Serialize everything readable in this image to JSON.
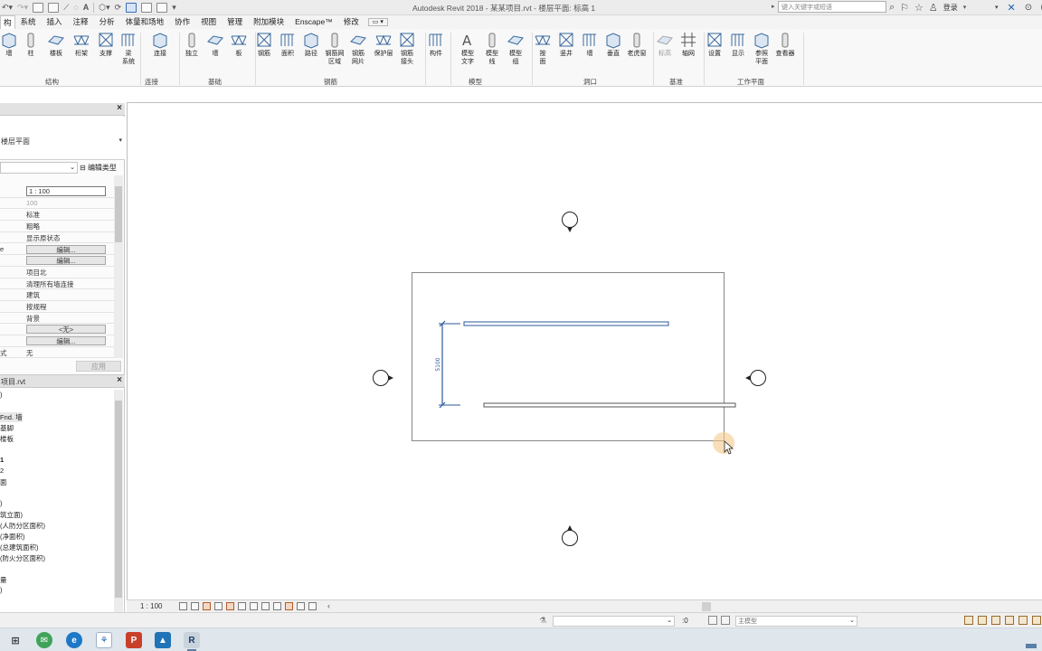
{
  "titlebar": {
    "title": "Autodesk Revit 2018 -    某某项目.rvt - 楼层平面: 标高 1",
    "search_placeholder": "键入关键字或短语",
    "login": "登录"
  },
  "tabs": [
    "构",
    "系统",
    "插入",
    "注释",
    "分析",
    "体量和场地",
    "协作",
    "视图",
    "管理",
    "附加模块",
    "Enscape™",
    "修改"
  ],
  "ribbon": {
    "buttons": [
      {
        "label": "墙"
      },
      {
        "label": "柱"
      },
      {
        "label": "楼板"
      },
      {
        "label": "桁架"
      },
      {
        "label": "支撑"
      },
      {
        "label": "梁\n系统"
      },
      {
        "label": "连接"
      },
      {
        "label": "独立"
      },
      {
        "label": "墙"
      },
      {
        "label": "板"
      },
      {
        "label": "钢筋"
      },
      {
        "label": "面积"
      },
      {
        "label": "路径"
      },
      {
        "label": "钢筋网\n区域"
      },
      {
        "label": "钢筋\n网片"
      },
      {
        "label": "保护层"
      },
      {
        "label": "钢筋\n接头"
      },
      {
        "label": "构件"
      },
      {
        "label": "模型\n文字"
      },
      {
        "label": "模型\n线"
      },
      {
        "label": "模型\n组"
      },
      {
        "label": "按\n面"
      },
      {
        "label": "竖井"
      },
      {
        "label": "墙"
      },
      {
        "label": "垂直"
      },
      {
        "label": "老虎窗"
      },
      {
        "label": "标高"
      },
      {
        "label": "轴网"
      },
      {
        "label": "设置"
      },
      {
        "label": "显示"
      },
      {
        "label": "参照\n平面"
      },
      {
        "label": "查看器"
      }
    ],
    "groups": [
      "结构",
      "连接",
      "基础",
      "钢筋",
      "模型",
      "洞口",
      "基准",
      "工作平面"
    ]
  },
  "properties": {
    "type_name": "楼层平面",
    "edit_type": "编辑类型",
    "apply": "应用",
    "rows": [
      {
        "key": "",
        "value": "1 : 100"
      },
      {
        "key": "",
        "value": "100"
      },
      {
        "key": "",
        "value": "标准"
      },
      {
        "key": "",
        "value": "粗略"
      },
      {
        "key": "",
        "value": "显示原状态"
      },
      {
        "key": "e",
        "value": "编辑..."
      },
      {
        "key": "",
        "value": "编辑..."
      },
      {
        "key": "",
        "value": "项目北"
      },
      {
        "key": "",
        "value": "清理所有墙连接"
      },
      {
        "key": "",
        "value": "建筑"
      },
      {
        "key": "",
        "value": "按规程"
      },
      {
        "key": "",
        "value": "背景"
      },
      {
        "key": "",
        "value": "<无>"
      },
      {
        "key": "",
        "value": "编辑..."
      },
      {
        "key": "式",
        "value": "无"
      }
    ]
  },
  "browser": {
    "title": "项目.rvt",
    "items": [
      ")",
      "Fnd. 墙",
      "基脚",
      "楼板",
      "1",
      "2",
      "面",
      ")",
      "筑立面)",
      "(人防分区面积)",
      "(净面积)",
      "(总建筑面积)",
      "(防火分区面积)",
      "量",
      ")"
    ]
  },
  "drawing": {
    "dimension_text": "5100"
  },
  "viewbar": {
    "scale": "1 : 100"
  },
  "statusbar": {
    "zero": ":0",
    "model": "主模型"
  }
}
